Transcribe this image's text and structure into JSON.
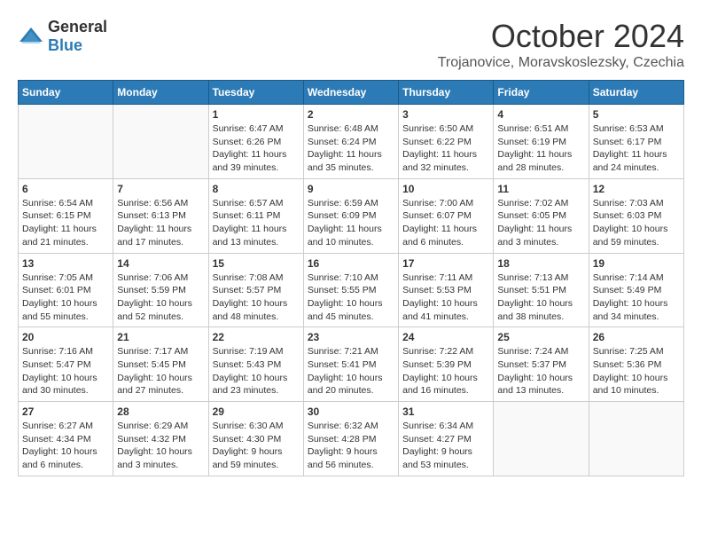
{
  "header": {
    "logo_general": "General",
    "logo_blue": "Blue",
    "month": "October 2024",
    "location": "Trojanovice, Moravskoslezsky, Czechia"
  },
  "weekdays": [
    "Sunday",
    "Monday",
    "Tuesday",
    "Wednesday",
    "Thursday",
    "Friday",
    "Saturday"
  ],
  "weeks": [
    [
      {
        "day": "",
        "sunrise": "",
        "sunset": "",
        "daylight": ""
      },
      {
        "day": "",
        "sunrise": "",
        "sunset": "",
        "daylight": ""
      },
      {
        "day": "1",
        "sunrise": "Sunrise: 6:47 AM",
        "sunset": "Sunset: 6:26 PM",
        "daylight": "Daylight: 11 hours and 39 minutes."
      },
      {
        "day": "2",
        "sunrise": "Sunrise: 6:48 AM",
        "sunset": "Sunset: 6:24 PM",
        "daylight": "Daylight: 11 hours and 35 minutes."
      },
      {
        "day": "3",
        "sunrise": "Sunrise: 6:50 AM",
        "sunset": "Sunset: 6:22 PM",
        "daylight": "Daylight: 11 hours and 32 minutes."
      },
      {
        "day": "4",
        "sunrise": "Sunrise: 6:51 AM",
        "sunset": "Sunset: 6:19 PM",
        "daylight": "Daylight: 11 hours and 28 minutes."
      },
      {
        "day": "5",
        "sunrise": "Sunrise: 6:53 AM",
        "sunset": "Sunset: 6:17 PM",
        "daylight": "Daylight: 11 hours and 24 minutes."
      }
    ],
    [
      {
        "day": "6",
        "sunrise": "Sunrise: 6:54 AM",
        "sunset": "Sunset: 6:15 PM",
        "daylight": "Daylight: 11 hours and 21 minutes."
      },
      {
        "day": "7",
        "sunrise": "Sunrise: 6:56 AM",
        "sunset": "Sunset: 6:13 PM",
        "daylight": "Daylight: 11 hours and 17 minutes."
      },
      {
        "day": "8",
        "sunrise": "Sunrise: 6:57 AM",
        "sunset": "Sunset: 6:11 PM",
        "daylight": "Daylight: 11 hours and 13 minutes."
      },
      {
        "day": "9",
        "sunrise": "Sunrise: 6:59 AM",
        "sunset": "Sunset: 6:09 PM",
        "daylight": "Daylight: 11 hours and 10 minutes."
      },
      {
        "day": "10",
        "sunrise": "Sunrise: 7:00 AM",
        "sunset": "Sunset: 6:07 PM",
        "daylight": "Daylight: 11 hours and 6 minutes."
      },
      {
        "day": "11",
        "sunrise": "Sunrise: 7:02 AM",
        "sunset": "Sunset: 6:05 PM",
        "daylight": "Daylight: 11 hours and 3 minutes."
      },
      {
        "day": "12",
        "sunrise": "Sunrise: 7:03 AM",
        "sunset": "Sunset: 6:03 PM",
        "daylight": "Daylight: 10 hours and 59 minutes."
      }
    ],
    [
      {
        "day": "13",
        "sunrise": "Sunrise: 7:05 AM",
        "sunset": "Sunset: 6:01 PM",
        "daylight": "Daylight: 10 hours and 55 minutes."
      },
      {
        "day": "14",
        "sunrise": "Sunrise: 7:06 AM",
        "sunset": "Sunset: 5:59 PM",
        "daylight": "Daylight: 10 hours and 52 minutes."
      },
      {
        "day": "15",
        "sunrise": "Sunrise: 7:08 AM",
        "sunset": "Sunset: 5:57 PM",
        "daylight": "Daylight: 10 hours and 48 minutes."
      },
      {
        "day": "16",
        "sunrise": "Sunrise: 7:10 AM",
        "sunset": "Sunset: 5:55 PM",
        "daylight": "Daylight: 10 hours and 45 minutes."
      },
      {
        "day": "17",
        "sunrise": "Sunrise: 7:11 AM",
        "sunset": "Sunset: 5:53 PM",
        "daylight": "Daylight: 10 hours and 41 minutes."
      },
      {
        "day": "18",
        "sunrise": "Sunrise: 7:13 AM",
        "sunset": "Sunset: 5:51 PM",
        "daylight": "Daylight: 10 hours and 38 minutes."
      },
      {
        "day": "19",
        "sunrise": "Sunrise: 7:14 AM",
        "sunset": "Sunset: 5:49 PM",
        "daylight": "Daylight: 10 hours and 34 minutes."
      }
    ],
    [
      {
        "day": "20",
        "sunrise": "Sunrise: 7:16 AM",
        "sunset": "Sunset: 5:47 PM",
        "daylight": "Daylight: 10 hours and 30 minutes."
      },
      {
        "day": "21",
        "sunrise": "Sunrise: 7:17 AM",
        "sunset": "Sunset: 5:45 PM",
        "daylight": "Daylight: 10 hours and 27 minutes."
      },
      {
        "day": "22",
        "sunrise": "Sunrise: 7:19 AM",
        "sunset": "Sunset: 5:43 PM",
        "daylight": "Daylight: 10 hours and 23 minutes."
      },
      {
        "day": "23",
        "sunrise": "Sunrise: 7:21 AM",
        "sunset": "Sunset: 5:41 PM",
        "daylight": "Daylight: 10 hours and 20 minutes."
      },
      {
        "day": "24",
        "sunrise": "Sunrise: 7:22 AM",
        "sunset": "Sunset: 5:39 PM",
        "daylight": "Daylight: 10 hours and 16 minutes."
      },
      {
        "day": "25",
        "sunrise": "Sunrise: 7:24 AM",
        "sunset": "Sunset: 5:37 PM",
        "daylight": "Daylight: 10 hours and 13 minutes."
      },
      {
        "day": "26",
        "sunrise": "Sunrise: 7:25 AM",
        "sunset": "Sunset: 5:36 PM",
        "daylight": "Daylight: 10 hours and 10 minutes."
      }
    ],
    [
      {
        "day": "27",
        "sunrise": "Sunrise: 6:27 AM",
        "sunset": "Sunset: 4:34 PM",
        "daylight": "Daylight: 10 hours and 6 minutes."
      },
      {
        "day": "28",
        "sunrise": "Sunrise: 6:29 AM",
        "sunset": "Sunset: 4:32 PM",
        "daylight": "Daylight: 10 hours and 3 minutes."
      },
      {
        "day": "29",
        "sunrise": "Sunrise: 6:30 AM",
        "sunset": "Sunset: 4:30 PM",
        "daylight": "Daylight: 9 hours and 59 minutes."
      },
      {
        "day": "30",
        "sunrise": "Sunrise: 6:32 AM",
        "sunset": "Sunset: 4:28 PM",
        "daylight": "Daylight: 9 hours and 56 minutes."
      },
      {
        "day": "31",
        "sunrise": "Sunrise: 6:34 AM",
        "sunset": "Sunset: 4:27 PM",
        "daylight": "Daylight: 9 hours and 53 minutes."
      },
      {
        "day": "",
        "sunrise": "",
        "sunset": "",
        "daylight": ""
      },
      {
        "day": "",
        "sunrise": "",
        "sunset": "",
        "daylight": ""
      }
    ]
  ]
}
